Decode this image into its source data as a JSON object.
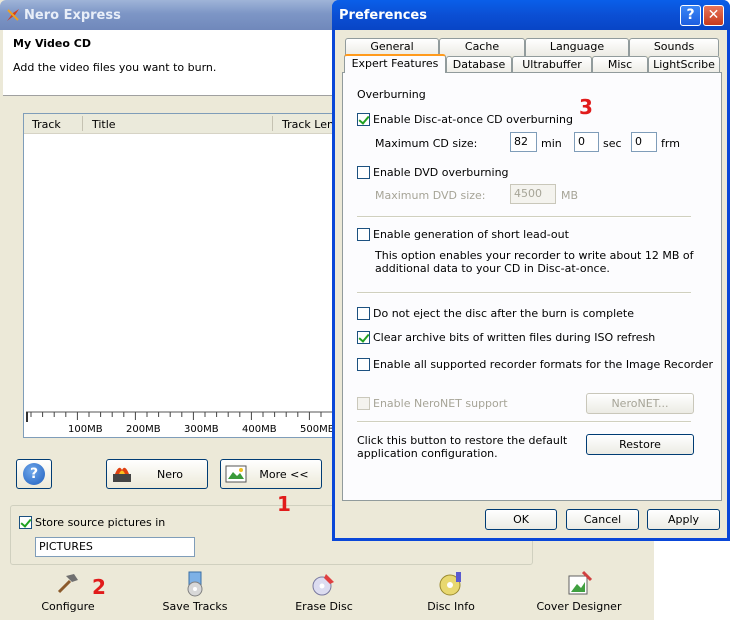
{
  "main_window": {
    "title": "Nero Express",
    "header_title": "My Video CD",
    "header_subtitle": "Add the video files you want to burn.",
    "columns": [
      "Track",
      "Title",
      "Track Leng"
    ],
    "ruler_labels": [
      "100MB",
      "200MB",
      "300MB",
      "400MB",
      "500MB"
    ],
    "nero_button": "Nero",
    "more_button": "More <<",
    "store_source_label": "Store source pictures in",
    "store_source_checked": true,
    "folder_value": "PICTURES",
    "toolbar": [
      {
        "label": "Configure",
        "icon": "hammer-icon"
      },
      {
        "label": "Save Tracks",
        "icon": "save-tracks-icon"
      },
      {
        "label": "Erase Disc",
        "icon": "erase-disc-icon"
      },
      {
        "label": "Disc Info",
        "icon": "disc-info-icon"
      },
      {
        "label": "Cover Designer",
        "icon": "cover-designer-icon"
      }
    ]
  },
  "annotations": [
    "1",
    "2",
    "3"
  ],
  "preferences": {
    "title": "Preferences",
    "tabs_row1": [
      "General",
      "Cache",
      "Language",
      "Sounds"
    ],
    "tabs_row2": [
      "Expert Features",
      "Database",
      "Ultrabuffer",
      "Misc",
      "LightScribe"
    ],
    "active_tab": "Expert Features",
    "overburning_heading": "Overburning",
    "cd_overburning_label": "Enable Disc-at-once CD overburning",
    "cd_overburning_checked": true,
    "max_cd_label": "Maximum CD size:",
    "max_cd_min": "82",
    "min_unit": "min",
    "max_cd_sec": "0",
    "sec_unit": "sec",
    "max_cd_frm": "0",
    "frm_unit": "frm",
    "dvd_overburning_label": "Enable DVD overburning",
    "dvd_overburning_checked": false,
    "max_dvd_label": "Maximum DVD size:",
    "max_dvd_value": "4500",
    "mb_unit": "MB",
    "short_leadout_label": "Enable generation of short lead-out",
    "short_leadout_checked": false,
    "short_leadout_desc_1": "This option enables your recorder to write about 12 MB of",
    "short_leadout_desc_2": "additional data to your CD in Disc-at-once.",
    "no_eject_label": "Do not eject the disc after the burn is complete",
    "no_eject_checked": false,
    "clear_archive_label": "Clear archive bits of written files during ISO refresh",
    "clear_archive_checked": true,
    "all_formats_label": "Enable all supported recorder formats for the Image Recorder",
    "all_formats_checked": false,
    "neronet_label": "Enable NeroNET support",
    "neronet_button": "NeroNET...",
    "restore_desc_1": "Click this button to restore the default",
    "restore_desc_2": "application configuration.",
    "restore_button": "Restore",
    "ok_button": "OK",
    "cancel_button": "Cancel",
    "apply_button": "Apply"
  },
  "colors": {
    "dialog_title": "#0a5fe9",
    "inactive_title": "#7d96c6",
    "annotation": "#e11b1b",
    "active_tab_highlight": "#ff9a1c"
  }
}
